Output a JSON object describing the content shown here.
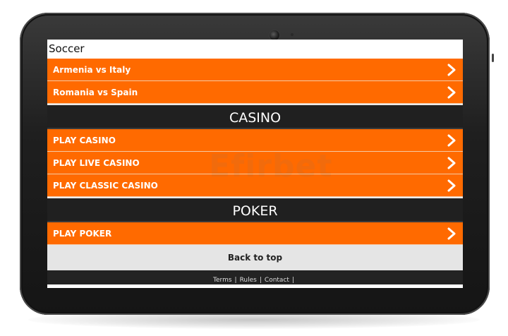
{
  "section": {
    "title": "Soccer"
  },
  "matches": [
    {
      "label": "Armenia vs Italy"
    },
    {
      "label": "Romania vs Spain"
    }
  ],
  "casino": {
    "heading": "CASINO",
    "items": [
      {
        "label": "PLAY CASINO"
      },
      {
        "label": "PLAY LIVE CASINO"
      },
      {
        "label": "PLAY CLASSIC CASINO"
      }
    ]
  },
  "poker": {
    "heading": "POKER",
    "items": [
      {
        "label": "PLAY POKER"
      }
    ]
  },
  "back_to_top": "Back to top",
  "footer": {
    "links": [
      "Terms",
      "Rules",
      "Contact"
    ],
    "separator": "|"
  },
  "watermark": "Efirbet",
  "colors": {
    "accent": "#ff6a00",
    "dark": "#202020",
    "light": "#e5e5e5"
  },
  "icons": {
    "row_arrow": "chevron-right-icon"
  }
}
